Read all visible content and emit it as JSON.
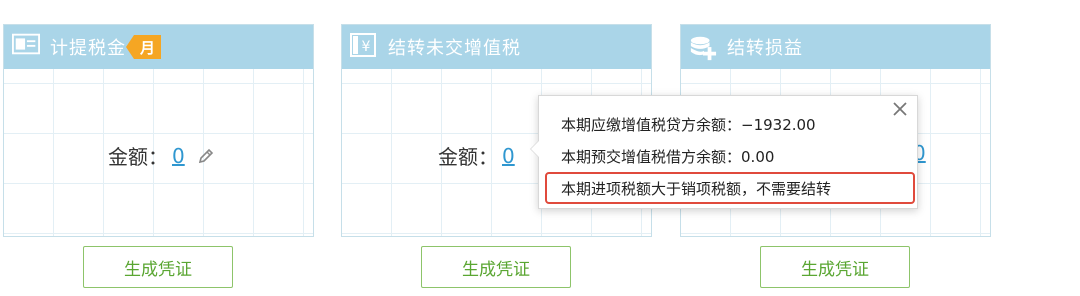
{
  "cards": [
    {
      "title": "计提税金",
      "badge": "月",
      "amount_label": "金额：",
      "amount_value": "0",
      "button": "生成凭证"
    },
    {
      "title": "结转未交增值税",
      "amount_label": "金额：",
      "amount_value": "0",
      "button": "生成凭证"
    },
    {
      "title": "结转损益",
      "amount_value": "0",
      "button": "生成凭证"
    }
  ],
  "popover": {
    "line1": "本期应缴增值税贷方余额：−1932.00",
    "line2": "本期预交增值税借方余额：0.00",
    "line3": "本期进项税额大于销项税额，不需要结转"
  },
  "colors": {
    "header_bg": "#aad5e8",
    "badge": "#f5a623",
    "link": "#2f97d0",
    "button_text": "#5aa632",
    "highlight_border": "#e04a3c"
  }
}
